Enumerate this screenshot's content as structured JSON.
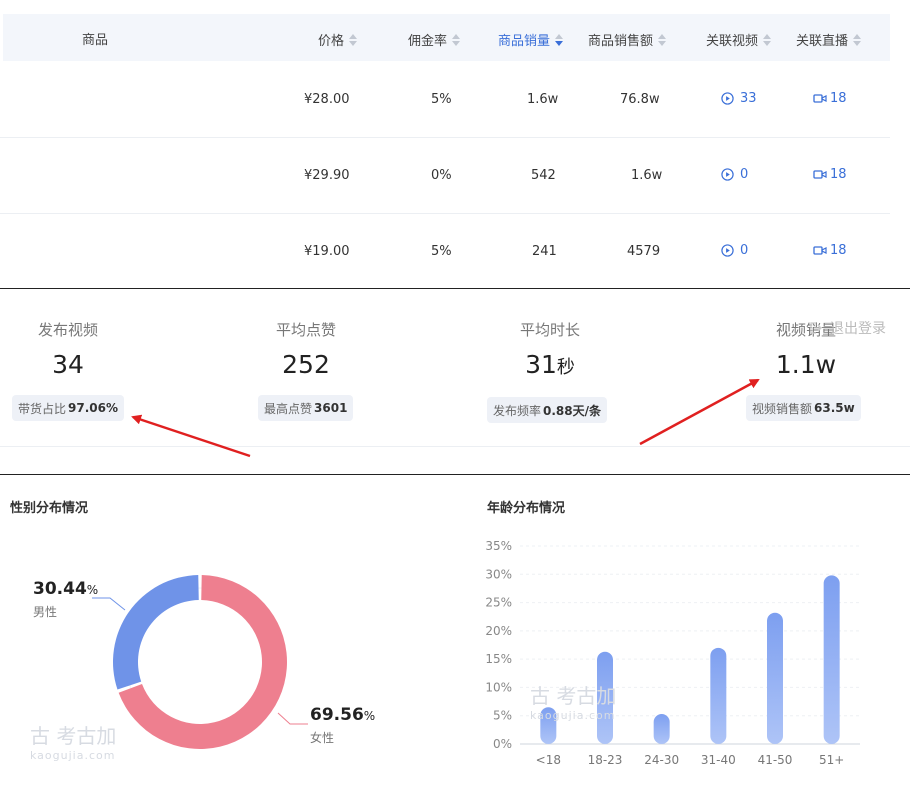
{
  "table": {
    "headers": {
      "product": "商品",
      "price": "价格",
      "commission": "佣金率",
      "sales_volume": "商品销量",
      "sales_amount": "商品销售额",
      "related_videos": "关联视频",
      "related_live": "关联直播"
    },
    "rows": [
      {
        "price": "¥28.00",
        "commission": "5%",
        "sales_volume": "1.6w",
        "sales_amount": "76.8w",
        "videos": "33",
        "live": "18"
      },
      {
        "price": "¥29.90",
        "commission": "0%",
        "sales_volume": "542",
        "sales_amount": "1.6w",
        "videos": "0",
        "live": "18"
      },
      {
        "price": "¥19.00",
        "commission": "5%",
        "sales_volume": "241",
        "sales_amount": "4579",
        "videos": "0",
        "live": "18"
      }
    ]
  },
  "stats": [
    {
      "label": "发布视频",
      "value": "34",
      "unit": "",
      "sub_label": "带货占比",
      "sub_value": "97.06%"
    },
    {
      "label": "平均点赞",
      "value": "252",
      "unit": "",
      "sub_label": "最高点赞",
      "sub_value": "3601"
    },
    {
      "label": "平均时长",
      "value": "31",
      "unit": "秒",
      "sub_label": "发布频率",
      "sub_value": "0.88天/条"
    },
    {
      "label": "视频销量",
      "value": "1.1w",
      "unit": "",
      "sub_label": "视频销售额",
      "sub_value": "63.5w"
    }
  ],
  "logout_label": "退出登录",
  "colors": {
    "accent": "#3a6fd8",
    "female": "#ee7f8f",
    "male": "#6f93e8",
    "bar": "#7d9ff0",
    "arrow": "#e02020"
  },
  "gender": {
    "title": "性别分布情况",
    "male": {
      "label": "男性",
      "value": "30.44",
      "unit": "%"
    },
    "female": {
      "label": "女性",
      "value": "69.56",
      "unit": "%"
    }
  },
  "age": {
    "title": "年龄分布情况"
  },
  "watermark": {
    "text": "考古加",
    "url": "kaogujia.com"
  },
  "chart_data": [
    {
      "type": "pie",
      "title": "性别分布情况",
      "categories": [
        "男性",
        "女性"
      ],
      "values": [
        30.44,
        69.56
      ]
    },
    {
      "type": "bar",
      "title": "年龄分布情况",
      "categories": [
        "<18",
        "18-23",
        "24-30",
        "31-40",
        "41-50",
        "51+"
      ],
      "values": [
        6.5,
        16.3,
        5.3,
        17.0,
        23.2,
        29.8
      ],
      "ylim": [
        0,
        35
      ],
      "yticks": [
        "0%",
        "5%",
        "10%",
        "15%",
        "20%",
        "25%",
        "30%",
        "35%"
      ],
      "grid": true
    }
  ]
}
